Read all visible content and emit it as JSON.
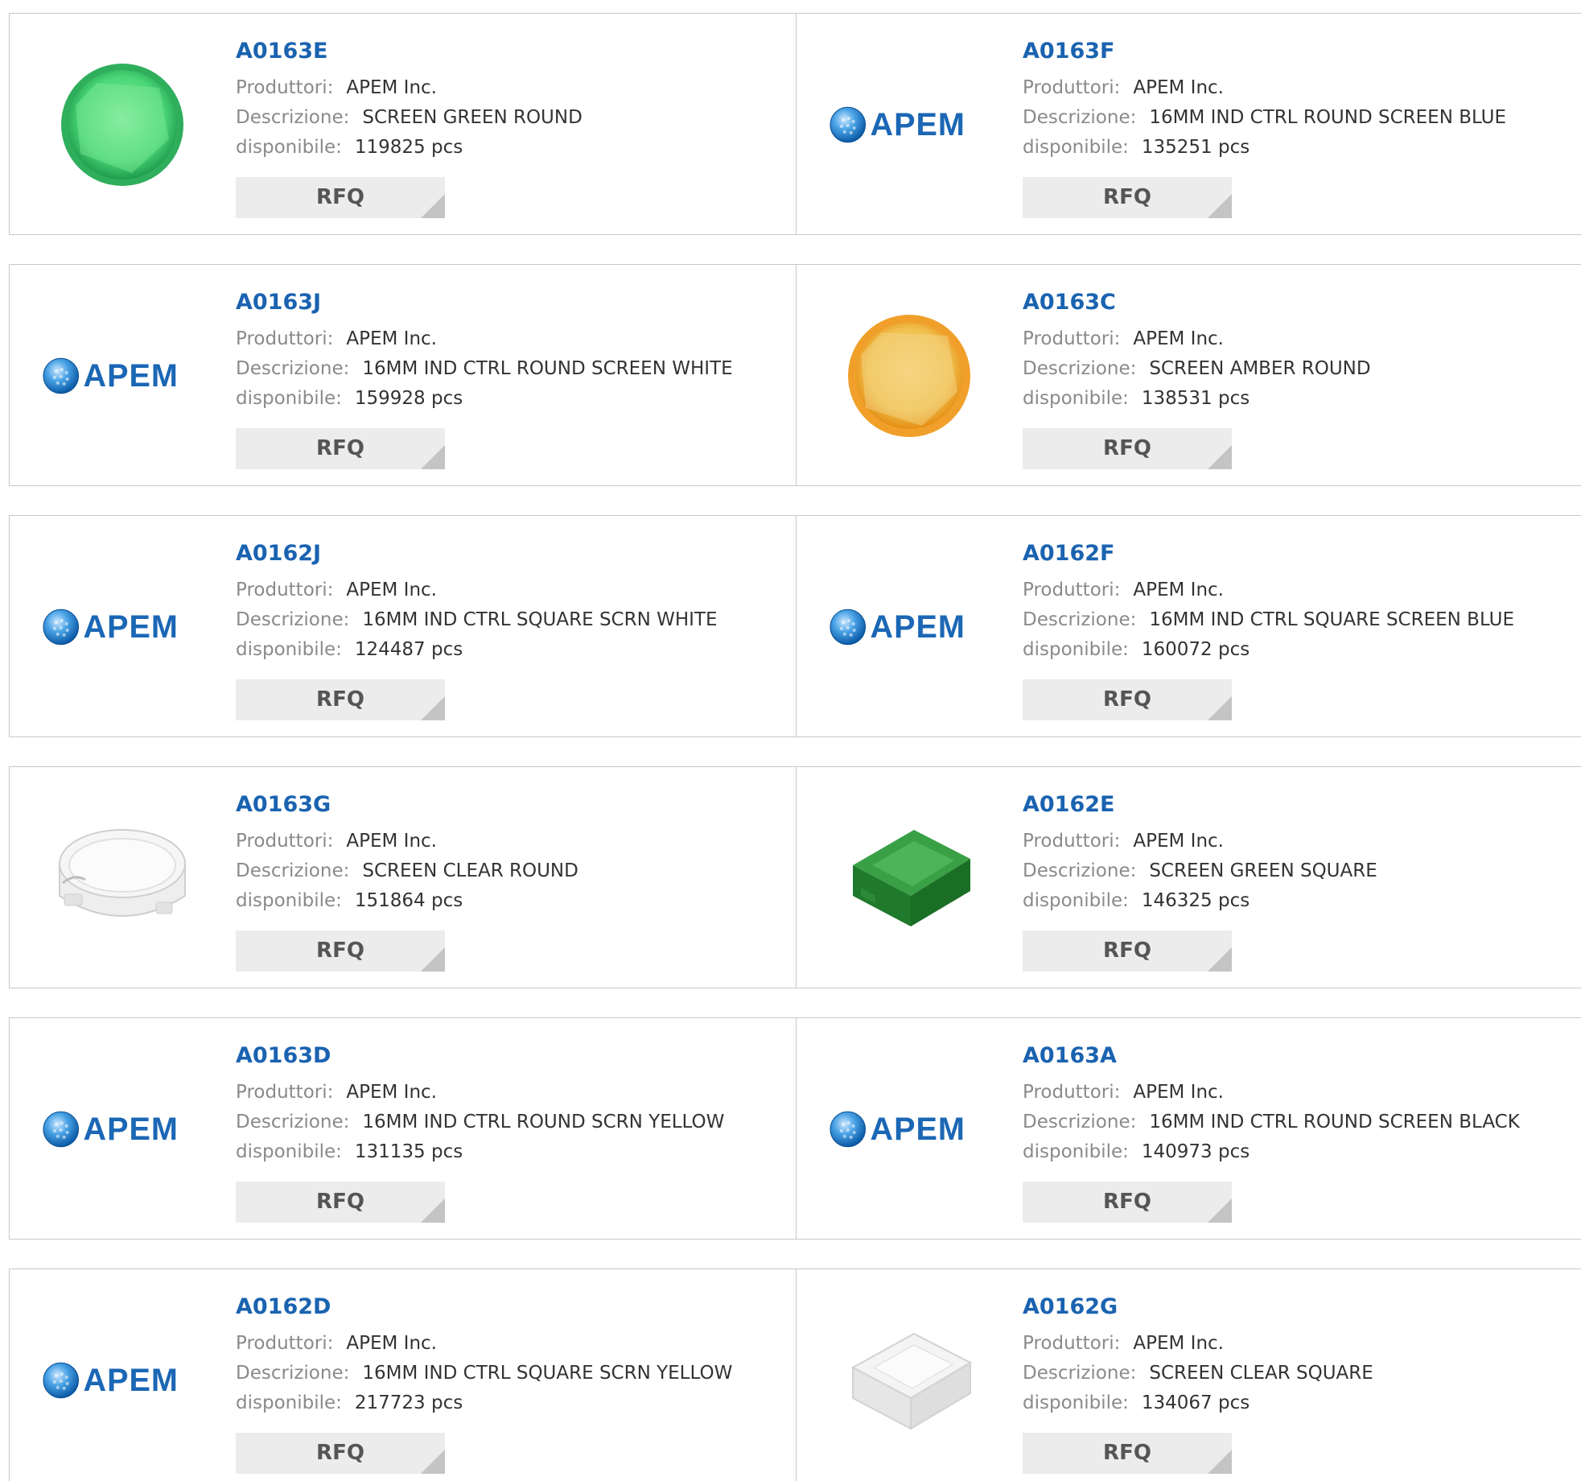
{
  "labels": {
    "manufacturer": "Produttori:",
    "description": "Descrizione:",
    "available": "disponibile:",
    "rfq": "RFQ"
  },
  "colors": {
    "part_link": "#1a63b0",
    "label": "#8a8a8a",
    "value": "#333333",
    "rfq_bg": "#ececec",
    "border": "#c8c8c8"
  },
  "rows": [
    [
      {
        "part": "A0163E",
        "manufacturer": "APEM Inc.",
        "description": "SCREEN GREEN ROUND",
        "stock": "119825 pcs",
        "image": "green-round-screen"
      },
      {
        "part": "A0163F",
        "manufacturer": "APEM Inc.",
        "description": "16MM IND CTRL ROUND SCREEN BLUE",
        "stock": "135251 pcs",
        "image": "apem-logo"
      }
    ],
    [
      {
        "part": "A0163J",
        "manufacturer": "APEM Inc.",
        "description": "16MM IND CTRL ROUND SCREEN WHITE",
        "stock": "159928 pcs",
        "image": "apem-logo"
      },
      {
        "part": "A0163C",
        "manufacturer": "APEM Inc.",
        "description": "SCREEN AMBER ROUND",
        "stock": "138531 pcs",
        "image": "amber-round-screen"
      }
    ],
    [
      {
        "part": "A0162J",
        "manufacturer": "APEM Inc.",
        "description": "16MM IND CTRL SQUARE SCRN WHITE",
        "stock": "124487 pcs",
        "image": "apem-logo"
      },
      {
        "part": "A0162F",
        "manufacturer": "APEM Inc.",
        "description": "16MM IND CTRL SQUARE SCREEN BLUE",
        "stock": "160072 pcs",
        "image": "apem-logo"
      }
    ],
    [
      {
        "part": "A0163G",
        "manufacturer": "APEM Inc.",
        "description": "SCREEN CLEAR ROUND",
        "stock": "151864 pcs",
        "image": "clear-round-screen"
      },
      {
        "part": "A0162E",
        "manufacturer": "APEM Inc.",
        "description": "SCREEN GREEN SQUARE",
        "stock": "146325 pcs",
        "image": "green-square-screen"
      }
    ],
    [
      {
        "part": "A0163D",
        "manufacturer": "APEM Inc.",
        "description": "16MM IND CTRL ROUND SCRN YELLOW",
        "stock": "131135 pcs",
        "image": "apem-logo"
      },
      {
        "part": "A0163A",
        "manufacturer": "APEM Inc.",
        "description": "16MM IND CTRL ROUND SCREEN BLACK",
        "stock": "140973 pcs",
        "image": "apem-logo"
      }
    ],
    [
      {
        "part": "A0162D",
        "manufacturer": "APEM Inc.",
        "description": "16MM IND CTRL SQUARE SCRN YELLOW",
        "stock": "217723 pcs",
        "image": "apem-logo"
      },
      {
        "part": "A0162G",
        "manufacturer": "APEM Inc.",
        "description": "SCREEN CLEAR SQUARE",
        "stock": "134067 pcs",
        "image": "clear-square-screen"
      }
    ]
  ],
  "logo": {
    "text": "APEM"
  }
}
